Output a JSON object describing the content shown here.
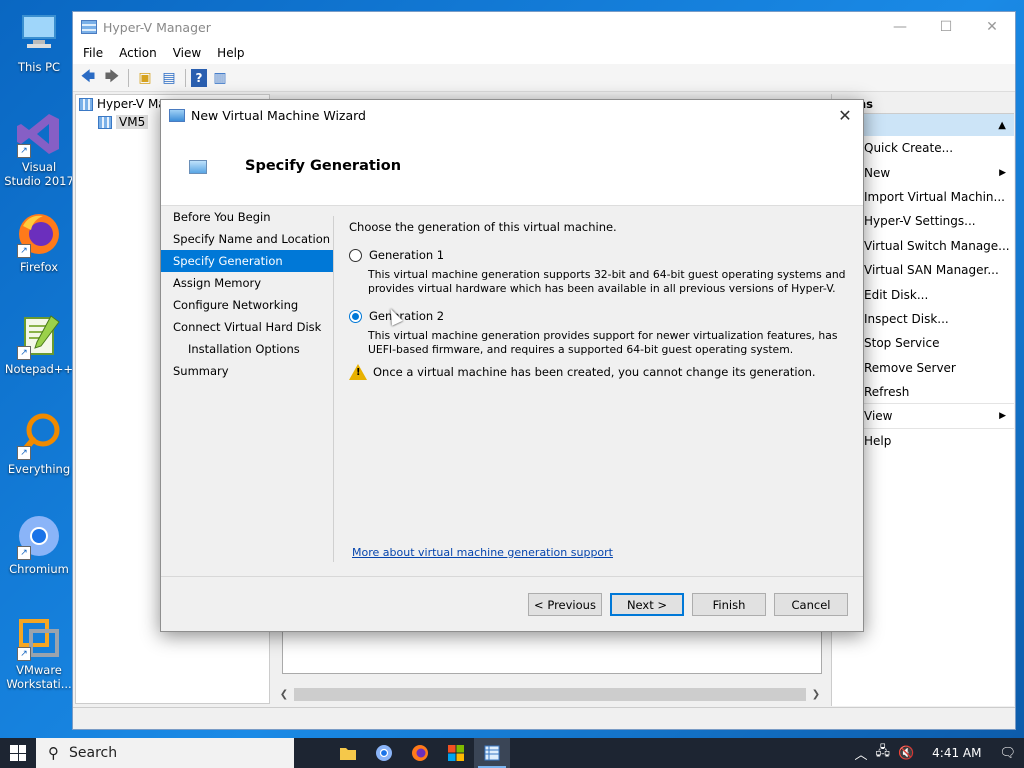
{
  "desktop": {
    "icons": [
      {
        "label": "This PC"
      },
      {
        "label": "Visual Studio 2017"
      },
      {
        "label": "Firefox"
      },
      {
        "label": "Notepad++"
      },
      {
        "label": "Everything"
      },
      {
        "label": "Chromium"
      },
      {
        "label": "VMware Workstati..."
      }
    ]
  },
  "hyperv": {
    "title": "Hyper-V Manager",
    "menu": [
      "File",
      "Action",
      "View",
      "Help"
    ],
    "tree": {
      "root": "Hyper-V Ma",
      "child": "VM5"
    },
    "actions_header": "ns",
    "actions": [
      {
        "label": "Quick Create..."
      },
      {
        "label": "New"
      },
      {
        "label": "Import Virtual Machin..."
      },
      {
        "label": "Hyper-V Settings..."
      },
      {
        "label": "Virtual Switch Manage..."
      },
      {
        "label": "Virtual SAN Manager..."
      },
      {
        "label": "Edit Disk..."
      },
      {
        "label": "Inspect Disk..."
      },
      {
        "label": "Stop Service"
      },
      {
        "label": "Remove Server"
      },
      {
        "label": "Refresh"
      },
      {
        "label": "View"
      },
      {
        "label": "Help"
      }
    ]
  },
  "wizard": {
    "title": "New Virtual Machine Wizard",
    "heading": "Specify Generation",
    "steps": [
      "Before You Begin",
      "Specify Name and Location",
      "Specify Generation",
      "Assign Memory",
      "Configure Networking",
      "Connect Virtual Hard Disk",
      "Installation Options",
      "Summary"
    ],
    "active_step": "Specify Generation",
    "intro": "Choose the generation of this virtual machine.",
    "gen1_label": "Generation 1",
    "gen1_desc": "This virtual machine generation supports 32-bit and 64-bit guest operating systems and provides virtual hardware which has been available in all previous versions of Hyper-V.",
    "gen2_label": "Generation 2",
    "gen2_desc": "This virtual machine generation provides support for newer virtualization features, has UEFI-based firmware, and requires a supported 64-bit guest operating system.",
    "selected": "Generation 2",
    "warning": "Once a virtual machine has been created, you cannot change its generation.",
    "link": "More about virtual machine generation support",
    "buttons": {
      "previous": "< Previous",
      "next": "Next >",
      "finish": "Finish",
      "cancel": "Cancel"
    }
  },
  "taskbar": {
    "search": "Search",
    "clock": "4:41 AM"
  },
  "colors": {
    "accent": "#0078d7",
    "desktop": "#1a8ae6",
    "taskbar": "#1d2532"
  }
}
